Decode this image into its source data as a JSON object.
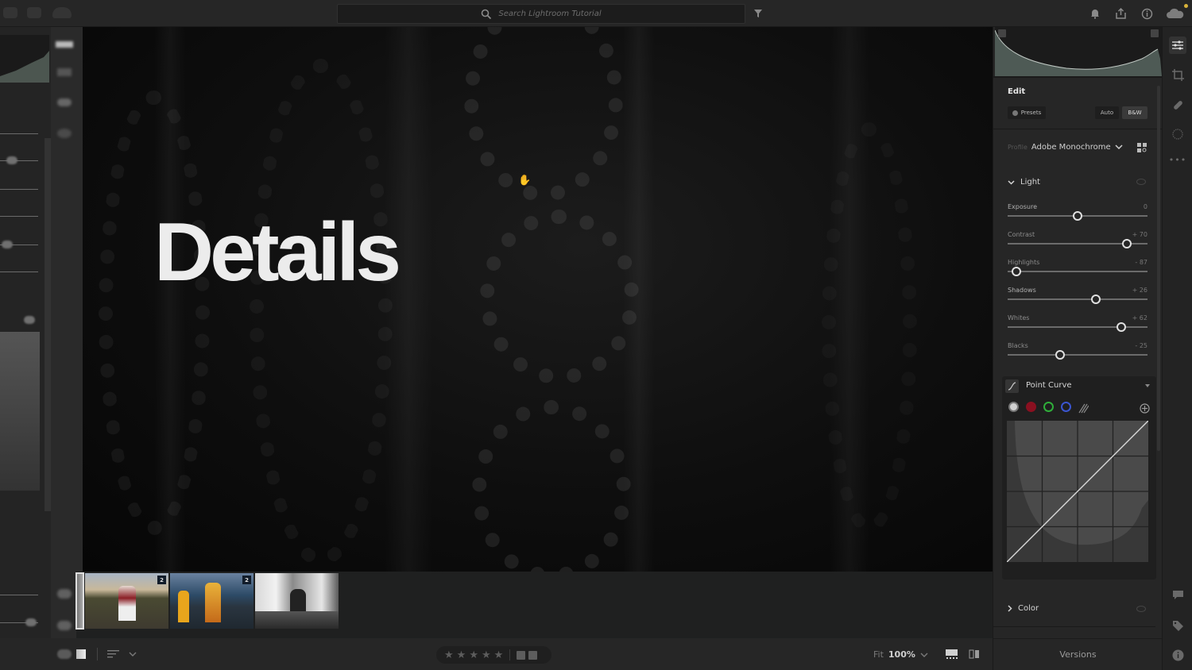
{
  "topbar": {
    "search_placeholder": "Search Lightroom Tutorial",
    "icons": [
      "notification-bell-icon",
      "share-icon",
      "help-icon",
      "cloud-sync-icon"
    ]
  },
  "overlay": {
    "title": "Details"
  },
  "filmstrip": {
    "thumbnails": [
      {
        "badge": "",
        "selected": true,
        "tone": "bw"
      },
      {
        "badge": "2",
        "selected": false,
        "tone": "sunset"
      },
      {
        "badge": "2",
        "selected": false,
        "tone": "coast"
      },
      {
        "badge": "",
        "selected": false,
        "tone": "bw"
      }
    ]
  },
  "bottombar": {
    "stars": [
      "★",
      "★",
      "★",
      "★",
      "★"
    ],
    "rating": 0,
    "zoom_fit_label": "Fit",
    "zoom_level": "100%"
  },
  "edit": {
    "title": "Edit",
    "presets_label": "Presets",
    "auto_label": "Auto",
    "bw_label": "B&W",
    "profile_label": "Profile",
    "profile_value": "Adobe Monochrome",
    "light": {
      "label": "Light",
      "sliders": [
        {
          "label": "Exposure",
          "display": "0",
          "value": 0,
          "min": -5,
          "max": 5
        },
        {
          "label": "Contrast",
          "display": "+ 70",
          "value": 70,
          "min": -100,
          "max": 100
        },
        {
          "label": "Highlights",
          "display": "- 87",
          "value": -87,
          "min": -100,
          "max": 100
        },
        {
          "label": "Shadows",
          "display": "+ 26",
          "value": 26,
          "min": -100,
          "max": 100
        },
        {
          "label": "Whites",
          "display": "+ 62",
          "value": 62,
          "min": -100,
          "max": 100
        },
        {
          "label": "Blacks",
          "display": "- 25",
          "value": -25,
          "min": -100,
          "max": 100
        }
      ]
    },
    "point_curve": {
      "label": "Point Curve",
      "channels": [
        {
          "name": "rgb",
          "color": "#d0d0d0"
        },
        {
          "name": "red",
          "color": "#8a1020"
        },
        {
          "name": "green",
          "color": "#2fae3a"
        },
        {
          "name": "blue",
          "color": "#3a55d0"
        }
      ]
    },
    "color": {
      "label": "Color"
    },
    "versions_label": "Versions"
  },
  "toolrail": {
    "top": [
      "edit-sliders-icon",
      "crop-icon",
      "healing-icon",
      "masking-icon",
      "more-icon"
    ],
    "bottom": [
      "comment-icon",
      "keyword-tag-icon",
      "info-icon"
    ]
  }
}
